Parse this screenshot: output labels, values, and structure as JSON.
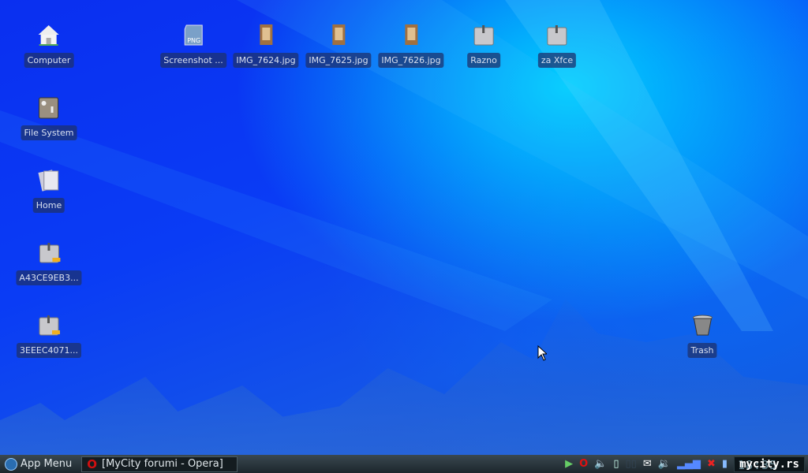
{
  "desktop": {
    "left_icons": [
      {
        "label": "Computer",
        "icon": "house-icon"
      },
      {
        "label": "File System",
        "icon": "harddisk-icon"
      },
      {
        "label": "Home",
        "icon": "home-folder-icon"
      },
      {
        "label": "A43CE9EB3...",
        "icon": "drive-icon"
      },
      {
        "label": "3EEEC4071...",
        "icon": "drive-icon"
      }
    ],
    "top_icons": [
      {
        "label": "Screenshot ...",
        "icon": "png-file-icon"
      },
      {
        "label": "IMG_7624.jpg",
        "icon": "image-file-icon"
      },
      {
        "label": "IMG_7625.jpg",
        "icon": "image-file-icon"
      },
      {
        "label": "IMG_7626.jpg",
        "icon": "image-file-icon"
      },
      {
        "label": "Razno",
        "icon": "folder-icon"
      },
      {
        "label": "za Xfce",
        "icon": "folder-icon"
      }
    ],
    "trash": {
      "label": "Trash"
    }
  },
  "taskbar": {
    "app_menu": "App Menu",
    "task": "[MyCity forumi - Opera]",
    "clock": "18:35",
    "watermark": "mycity.rs"
  }
}
